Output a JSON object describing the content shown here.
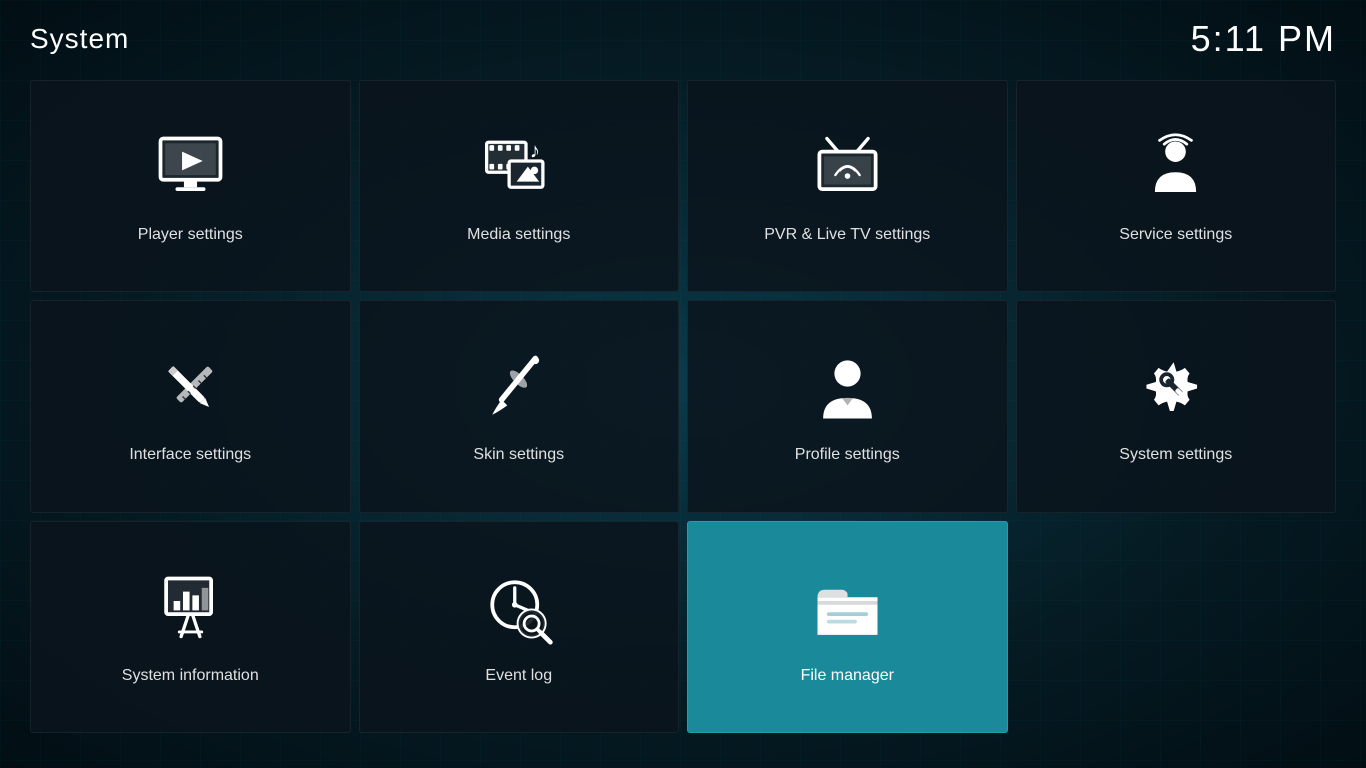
{
  "header": {
    "title": "System",
    "clock": "5:11 PM"
  },
  "tiles": [
    {
      "id": "player-settings",
      "label": "Player settings",
      "icon": "player",
      "active": false
    },
    {
      "id": "media-settings",
      "label": "Media settings",
      "icon": "media",
      "active": false
    },
    {
      "id": "pvr-settings",
      "label": "PVR & Live TV settings",
      "icon": "pvr",
      "active": false
    },
    {
      "id": "service-settings",
      "label": "Service settings",
      "icon": "service",
      "active": false
    },
    {
      "id": "interface-settings",
      "label": "Interface settings",
      "icon": "interface",
      "active": false
    },
    {
      "id": "skin-settings",
      "label": "Skin settings",
      "icon": "skin",
      "active": false
    },
    {
      "id": "profile-settings",
      "label": "Profile settings",
      "icon": "profile",
      "active": false
    },
    {
      "id": "system-settings",
      "label": "System settings",
      "icon": "system",
      "active": false
    },
    {
      "id": "system-information",
      "label": "System information",
      "icon": "sysinfo",
      "active": false
    },
    {
      "id": "event-log",
      "label": "Event log",
      "icon": "eventlog",
      "active": false
    },
    {
      "id": "file-manager",
      "label": "File manager",
      "icon": "filemanager",
      "active": true
    }
  ]
}
